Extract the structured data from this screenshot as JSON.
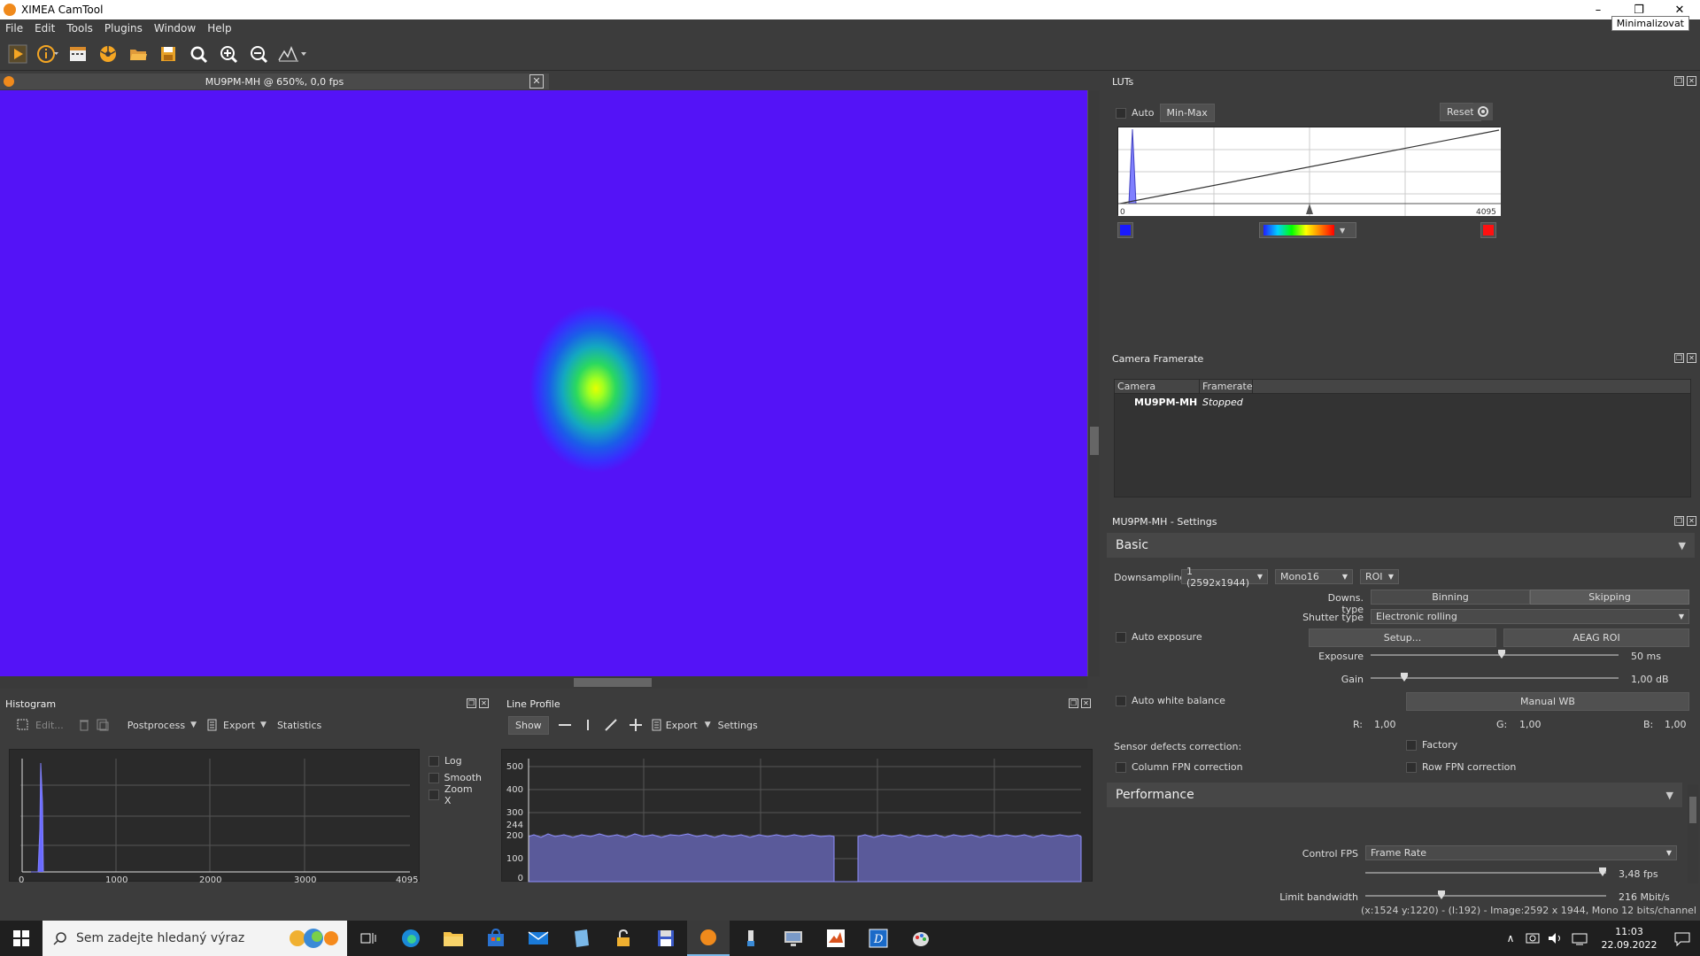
{
  "window": {
    "title": "XIMEA CamTool",
    "tooltip": "Minimalizovat",
    "min": "–",
    "restore": "❐",
    "close": "✕"
  },
  "menu": [
    "File",
    "Edit",
    "Tools",
    "Plugins",
    "Window",
    "Help"
  ],
  "viewer": {
    "title": "MU9PM-MH @ 650%, 0,0 fps",
    "close": "✕"
  },
  "histogram": {
    "title": "Histogram",
    "edit": "Edit...",
    "postprocess": "Postprocess",
    "export": "Export",
    "statistics": "Statistics",
    "options": [
      "Log",
      "Smooth",
      "Zoom X"
    ],
    "x_ticks": [
      "0",
      "1000",
      "2000",
      "3000",
      "4095"
    ]
  },
  "lineprofile": {
    "title": "Line Profile",
    "show": "Show",
    "export": "Export",
    "settings": "Settings",
    "y_ticks": [
      "500",
      "400",
      "300",
      "244",
      "200",
      "100",
      "0"
    ]
  },
  "luts": {
    "title": "LUTs",
    "auto": "Auto",
    "minmax": "Min-Max",
    "reset": "Reset",
    "min": "0",
    "max": "4095"
  },
  "framerate": {
    "title": "Camera Framerate",
    "col_camera": "Camera",
    "col_framerate": "Framerate",
    "camera": "MU9PM-MH",
    "status": "Stopped"
  },
  "settings": {
    "title": "MU9PM-MH - Settings",
    "basic": "Basic",
    "downsampling_label": "Downsampling",
    "downsampling_value": "1 (2592x1944)",
    "format": "Mono16",
    "roi": "ROI",
    "downs_type_label": "Downs. type",
    "binning": "Binning",
    "skipping": "Skipping",
    "shutter_label": "Shutter type",
    "shutter_value": "Electronic rolling",
    "auto_exposure": "Auto exposure",
    "setup": "Setup...",
    "aeag_roi": "AEAG ROI",
    "exposure_label": "Exposure",
    "exposure_value": "50 ms",
    "gain_label": "Gain",
    "gain_value": "1,00 dB",
    "auto_wb": "Auto white balance",
    "manual_wb": "Manual WB",
    "r_label": "R:",
    "r_value": "1,00",
    "g_label": "G:",
    "g_value": "1,00",
    "b_label": "B:",
    "b_value": "1,00",
    "sensor_defects": "Sensor defects correction:",
    "factory": "Factory",
    "column_fpn": "Column FPN correction",
    "row_fpn": "Row FPN correction",
    "performance": "Performance",
    "control_fps_label": "Control FPS",
    "control_fps_value": "Frame Rate",
    "fps_value": "3,48 fps",
    "limit_bw_label": "Limit bandwidth",
    "bw_value": "216 Mbit/s"
  },
  "status": "(x:1524 y:1220) - (I:192) - Image:2592 x 1944, Mono 12 bits/channel",
  "taskbar": {
    "search_placeholder": "Sem zadejte hledaný výraz",
    "time": "11:03",
    "date": "22.09.2022"
  }
}
